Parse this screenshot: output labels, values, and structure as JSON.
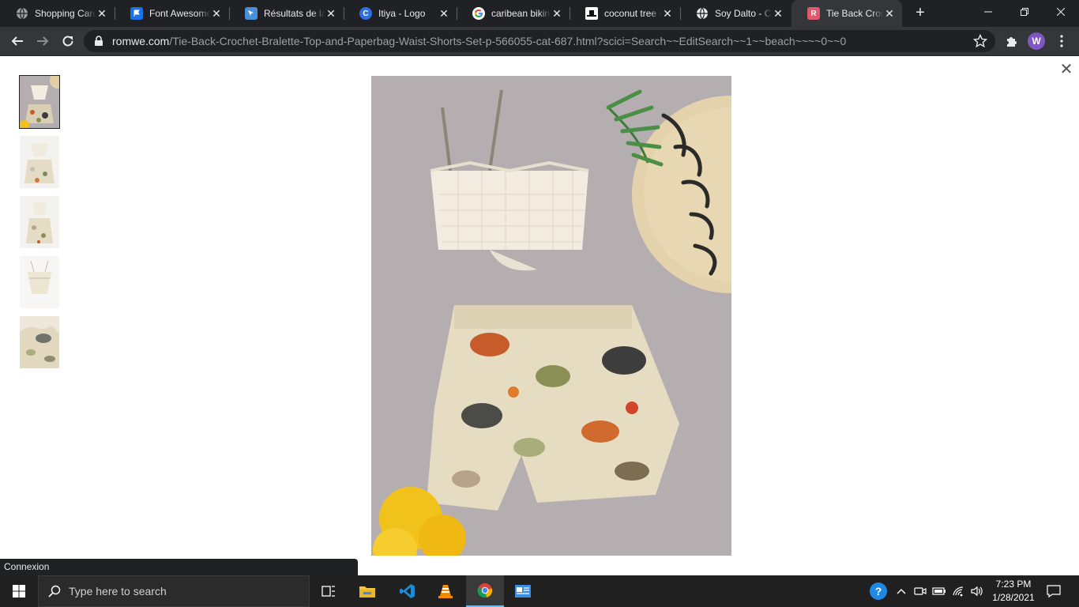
{
  "browser": {
    "tabs": [
      {
        "title": "Shopping Card",
        "icon": "globe-icon",
        "color": "#9aa0a6"
      },
      {
        "title": "Font Awesome",
        "icon": "flag-icon",
        "color": "#1a73e8"
      },
      {
        "title": "Résultats de la",
        "icon": "pointer-icon",
        "color": "#4a90d9"
      },
      {
        "title": "Itiya - Logo",
        "icon": "c-icon",
        "color": "#2f6fdf"
      },
      {
        "title": "caribean bikini",
        "icon": "google-icon",
        "color": "#ffffff"
      },
      {
        "title": "coconut tree n",
        "icon": "hat-icon",
        "color": "#ffffff"
      },
      {
        "title": "Soy Dalto - Cu",
        "icon": "globe-icon",
        "color": "#9aa0a6"
      },
      {
        "title": "Tie Back Croch",
        "icon": "romwe-icon",
        "color": "#e05a6d"
      }
    ],
    "active_tab_index": 7,
    "url_host": "romwe.com",
    "url_path": "/Tie-Back-Crochet-Bralette-Top-and-Paperbag-Waist-Shorts-Set-p-566055-cat-687.html?scici=Search~~EditSearch~~1~~beach~~~~0~~0",
    "profile_initial": "W"
  },
  "status_bar": {
    "text": "Connexion"
  },
  "taskbar": {
    "search_placeholder": "Type here to search",
    "time": "7:23 PM",
    "date": "1/28/2021"
  },
  "colors": {
    "image_bg": "#b5aeb1",
    "accent": "#76b9ed"
  }
}
